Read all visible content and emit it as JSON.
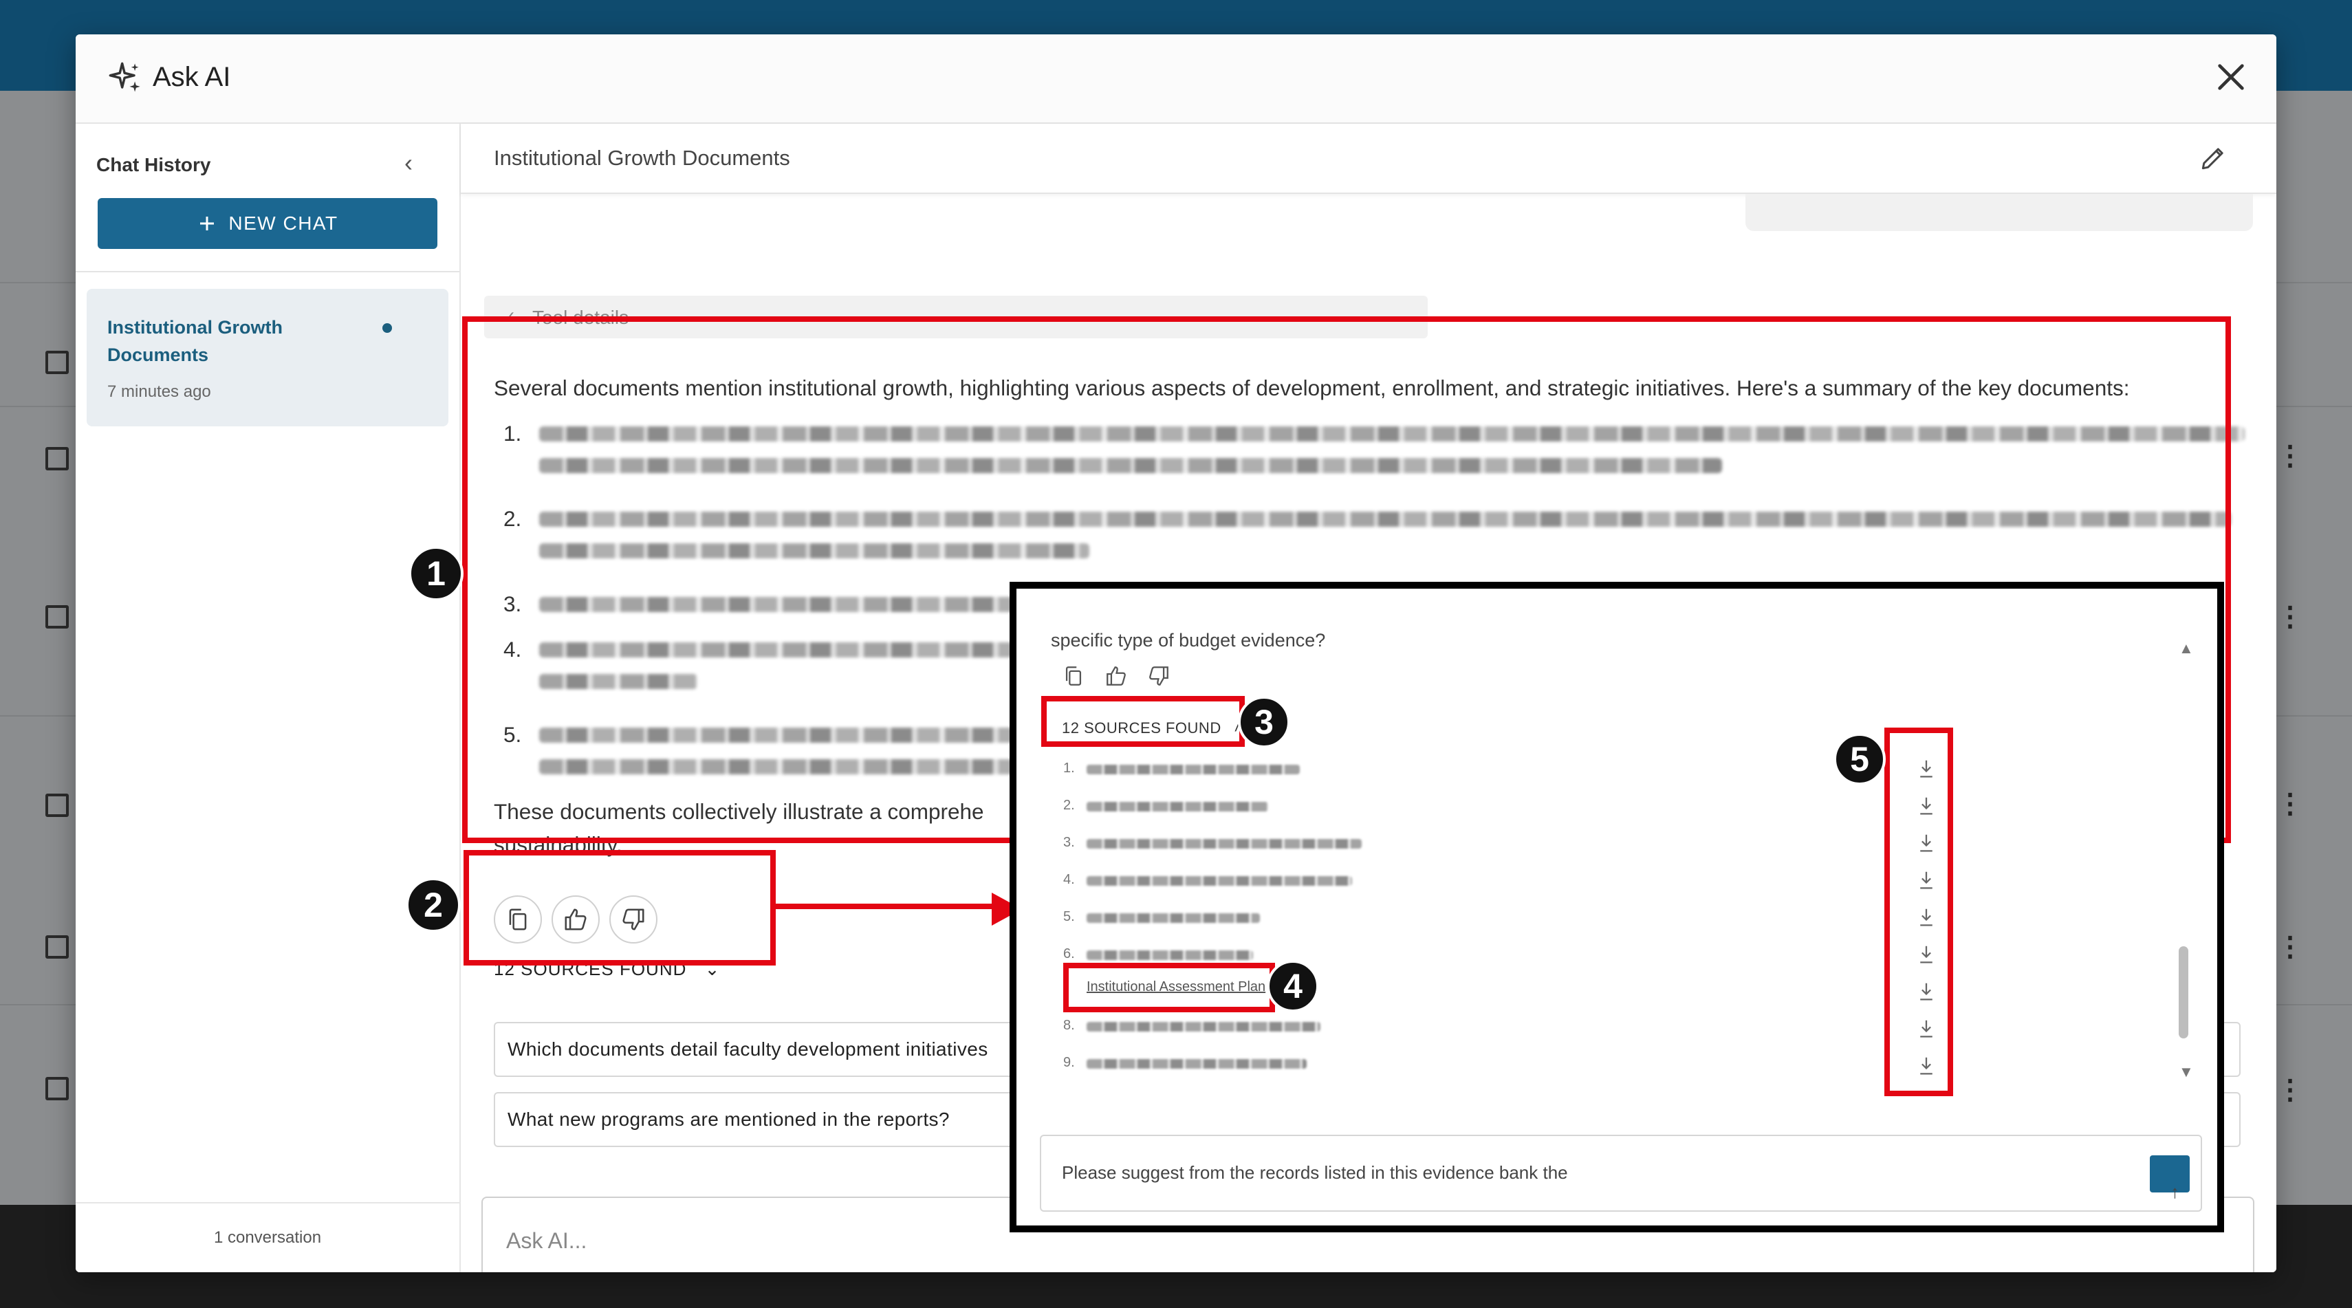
{
  "modal": {
    "title": "Ask AI"
  },
  "sidebar": {
    "title": "Chat History",
    "new_chat_label": "NEW CHAT",
    "chat_item": {
      "title": "Institutional Growth Documents",
      "time": "7 minutes ago"
    },
    "footer": "1 conversation"
  },
  "main": {
    "conversation_title": "Institutional Growth Documents",
    "tool_details_label": "Tool details",
    "answer_intro": "Several documents mention institutional growth, highlighting various aspects of development, enrollment, and strategic initiatives. Here's a summary of the key documents:",
    "list_numbers": [
      "1.",
      "2.",
      "3.",
      "4.",
      "5."
    ],
    "answer_summary": "These documents collectively illustrate a comprehe",
    "answer_summary_end": "sustainability.",
    "sources_toggle": "12 SOURCES FOUND",
    "suggestions": [
      "Which documents detail faculty development initiatives",
      "What new programs are mentioned in the reports?"
    ],
    "ask_placeholder": "Ask AI..."
  },
  "inset": {
    "question_fragment": "specific type of budget evidence?",
    "sources_label": "12 SOURCES FOUND",
    "source_numbers": [
      "1.",
      "2.",
      "3.",
      "4.",
      "5.",
      "6.",
      "7.",
      "8.",
      "9."
    ],
    "highlight_link": "Institutional Assessment Plan",
    "input_text": "Please suggest from the records listed in this evidence bank the"
  },
  "callouts": [
    "1",
    "2",
    "3",
    "4",
    "5"
  ],
  "colors": {
    "brand": "#1b6791",
    "callout": "#e30613",
    "badge": "#111111"
  }
}
